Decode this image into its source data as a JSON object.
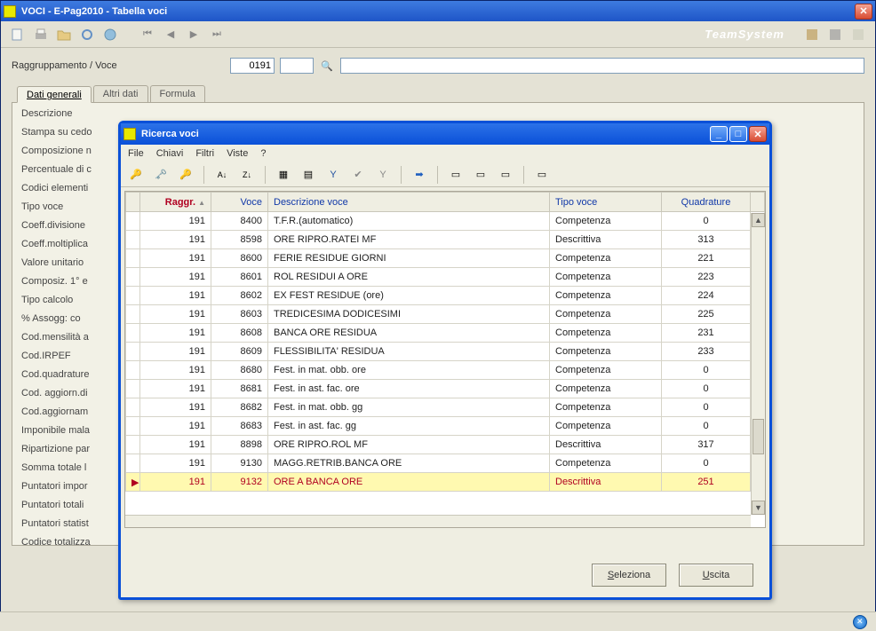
{
  "main_window": {
    "title": "VOCI  -  E-Pag2010  -  Tabella voci",
    "logo": "TeamSystem"
  },
  "form": {
    "label": "Raggruppamento / Voce",
    "code": "0191"
  },
  "tabs": [
    "Dati generali",
    "Altri dati",
    "Formula"
  ],
  "field_list": [
    "Descrizione",
    "Stampa su cedo",
    "Composizione n",
    "Percentuale di c",
    "Codici elementi",
    "Tipo voce",
    "Coeff.divisione",
    "Coeff.moltiplica",
    "Valore unitario",
    "Composiz. 1° e",
    "Tipo calcolo",
    "% Assogg:    co",
    "Cod.mensilità a",
    "Cod.IRPEF",
    "Cod.quadrature",
    "Cod. aggiorn.di",
    "Cod.aggiornam",
    "Imponibile mala",
    "Ripartizione par",
    "Somma totale l",
    "Puntatori impor",
    "Puntatori totali",
    "Puntatori statist",
    "Codice totalizza"
  ],
  "modal": {
    "title": "Ricerca voci",
    "menus": [
      "File",
      "Chiavi",
      "Filtri",
      "Viste",
      "?"
    ],
    "columns": {
      "raggr": "Raggr.",
      "voce": "Voce",
      "descr": "Descrizione voce",
      "tipo": "Tipo voce",
      "quad": "Quadrature"
    },
    "rows": [
      {
        "raggr": "191",
        "voce": "8400",
        "descr": "T.F.R.(automatico)",
        "tipo": "Competenza",
        "quad": "0"
      },
      {
        "raggr": "191",
        "voce": "8598",
        "descr": "ORE RIPRO.RATEI MF",
        "tipo": "Descrittiva",
        "quad": "313"
      },
      {
        "raggr": "191",
        "voce": "8600",
        "descr": "FERIE RESIDUE GIORNI",
        "tipo": "Competenza",
        "quad": "221"
      },
      {
        "raggr": "191",
        "voce": "8601",
        "descr": "ROL RESIDUI A ORE",
        "tipo": "Competenza",
        "quad": "223"
      },
      {
        "raggr": "191",
        "voce": "8602",
        "descr": "EX FEST RESIDUE (ore)",
        "tipo": "Competenza",
        "quad": "224"
      },
      {
        "raggr": "191",
        "voce": "8603",
        "descr": "TREDICESIMA DODICESIMI",
        "tipo": "Competenza",
        "quad": "225"
      },
      {
        "raggr": "191",
        "voce": "8608",
        "descr": "BANCA ORE RESIDUA",
        "tipo": "Competenza",
        "quad": "231"
      },
      {
        "raggr": "191",
        "voce": "8609",
        "descr": "FLESSIBILITA' RESIDUA",
        "tipo": "Competenza",
        "quad": "233"
      },
      {
        "raggr": "191",
        "voce": "8680",
        "descr": "Fest. in mat. obb. ore",
        "tipo": "Competenza",
        "quad": "0"
      },
      {
        "raggr": "191",
        "voce": "8681",
        "descr": "Fest. in ast. fac. ore",
        "tipo": "Competenza",
        "quad": "0"
      },
      {
        "raggr": "191",
        "voce": "8682",
        "descr": "Fest. in mat. obb. gg",
        "tipo": "Competenza",
        "quad": "0"
      },
      {
        "raggr": "191",
        "voce": "8683",
        "descr": "Fest. in ast. fac. gg",
        "tipo": "Competenza",
        "quad": "0"
      },
      {
        "raggr": "191",
        "voce": "8898",
        "descr": "ORE RIPRO.ROL MF",
        "tipo": "Descrittiva",
        "quad": "317"
      },
      {
        "raggr": "191",
        "voce": "9130",
        "descr": "MAGG.RETRIB.BANCA ORE",
        "tipo": "Competenza",
        "quad": "0"
      },
      {
        "raggr": "191",
        "voce": "9132",
        "descr": "ORE A BANCA ORE",
        "tipo": "Descrittiva",
        "quad": "251",
        "selected": true
      }
    ],
    "buttons": {
      "select": "Seleziona",
      "exit": "Uscita"
    }
  }
}
